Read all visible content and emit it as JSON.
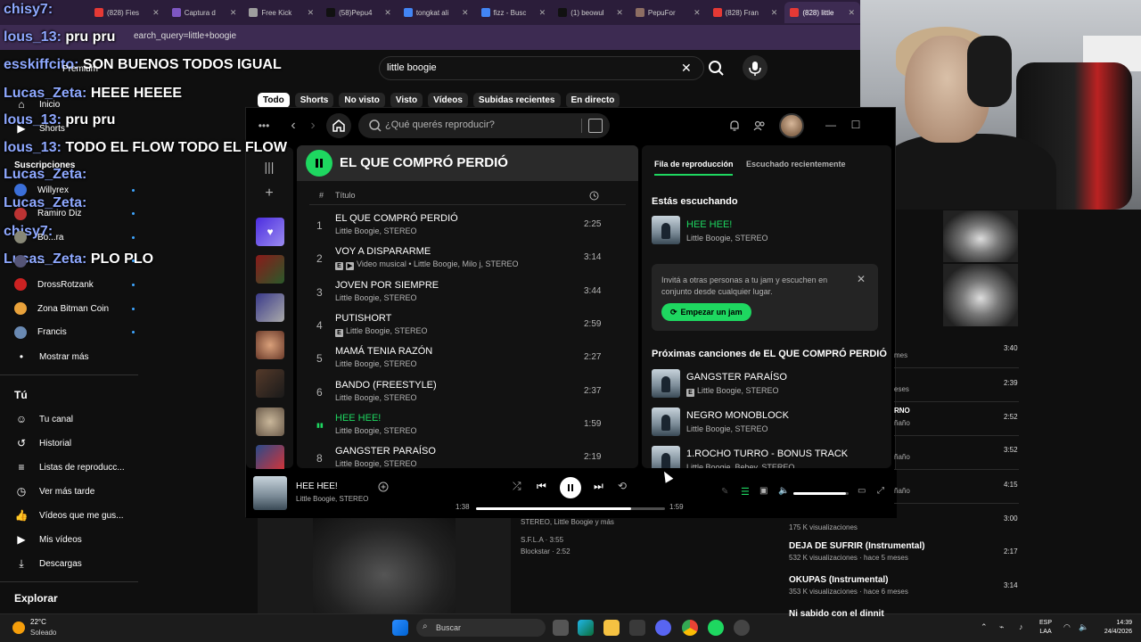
{
  "browser": {
    "tabs": [
      {
        "label": "(828) Fies",
        "color": "#e53935"
      },
      {
        "label": "Captura d",
        "color": "#7e57c2"
      },
      {
        "label": "Free Kick",
        "color": "#9e9e9e"
      },
      {
        "label": "(58)Pepu4",
        "color": "#111111"
      },
      {
        "label": "tongkat ali",
        "color": "#4285f4"
      },
      {
        "label": "fizz - Busc",
        "color": "#4285f4"
      },
      {
        "label": "(1) beowul",
        "color": "#111111"
      },
      {
        "label": "PepuFor",
        "color": "#8d6e63"
      },
      {
        "label": "(828) Fran",
        "color": "#e53935"
      },
      {
        "label": "(828) little",
        "color": "#e53935"
      }
    ],
    "url_fragment": "earch_query=little+boogie"
  },
  "youtube": {
    "search_value": "little boogie",
    "premium_label": "Premium",
    "chips": [
      "Todo",
      "Shorts",
      "No visto",
      "Visto",
      "Vídeos",
      "Subidas recientes",
      "En directo"
    ],
    "nav_main": [
      {
        "label": "Inicio",
        "icon": "home-icon"
      },
      {
        "label": "Shorts",
        "icon": "shorts-icon"
      }
    ],
    "subs_header": "Suscripciones",
    "subscriptions": [
      "Willyrex",
      "Ramiro Diz",
      "Bo...ra",
      "...",
      "DrossRotzank",
      "Zona Bitman Coin",
      "Francis"
    ],
    "show_more": "Mostrar más",
    "you_header": "Tú",
    "you_items": [
      {
        "label": "Tu canal",
        "icon": "channel-icon"
      },
      {
        "label": "Historial",
        "icon": "history-icon"
      },
      {
        "label": "Listas de reproducc...",
        "icon": "playlist-icon"
      },
      {
        "label": "Ver más tarde",
        "icon": "clock-icon"
      },
      {
        "label": "Vídeos que me gus...",
        "icon": "like-icon"
      },
      {
        "label": "Mis vídeos",
        "icon": "video-icon"
      },
      {
        "label": "Descargas",
        "icon": "download-icon"
      }
    ],
    "explore_header": "Explorar",
    "under_thumb": [
      "STEREO, Little Boogie y más",
      "S.F.L.A · 3:55",
      "Blockstar · 2:52"
    ],
    "right_durations": [
      "3:40",
      "2:39",
      "2:52",
      "3:52",
      "4:15",
      "3:00",
      "2:17",
      "3:14"
    ],
    "right_partials": [
      "mes",
      "eses",
      "RNO",
      "ñaño",
      "ñaño",
      "ñaño",
      "ñaño"
    ],
    "results": [
      {
        "title": "",
        "meta": "175 K visualizaciones"
      },
      {
        "title": "DEJA DE SUFRIR (Instrumental)",
        "meta": "532 K visualizaciones · hace 5 meses"
      },
      {
        "title": "OKUPAS (Instrumental)",
        "meta": "353 K visualizaciones · hace 6 meses"
      },
      {
        "title": "Ni sabido con el dinnit",
        "meta": ""
      }
    ]
  },
  "chat": [
    {
      "user": "chisy7:",
      "msg": ""
    },
    {
      "user": "lous_13:",
      "msg": " pru pru"
    },
    {
      "user": "esskiffcito:",
      "msg": " SON BUENOS TODOS IGUAL"
    },
    {
      "user": "Lucas_Zeta:",
      "msg": " HEEE HEEEE"
    },
    {
      "user": "lous_13:",
      "msg": " pru pru"
    },
    {
      "user": "lous_13:",
      "msg": " TODO EL FLOW TODO EL FLOW"
    },
    {
      "user": "Lucas_Zeta:",
      "msg": ""
    },
    {
      "user": "Lucas_Zeta:",
      "msg": ""
    },
    {
      "user": "chisy7:",
      "msg": ""
    },
    {
      "user": "Lucas_Zeta:",
      "msg": " PLO PLO"
    }
  ],
  "spotify": {
    "search_placeholder": "¿Qué querés reproducir?",
    "playlist_title": "EL QUE COMPRÓ PERDIÓ",
    "col_number": "#",
    "col_title": "Título",
    "tracks": [
      {
        "n": "1",
        "title": "EL QUE COMPRÓ PERDIÓ",
        "artist": "Little Boogie, STEREO",
        "dur": "2:25",
        "explicit": false,
        "video": false,
        "playing": false
      },
      {
        "n": "2",
        "title": "VOY A DISPARARME",
        "artist": "Video musical • Little Boogie, Milo j, STEREO",
        "dur": "3:14",
        "explicit": true,
        "video": true,
        "playing": false
      },
      {
        "n": "3",
        "title": "JOVEN POR SIEMPRE",
        "artist": "Little Boogie, STEREO",
        "dur": "3:44",
        "explicit": false,
        "video": false,
        "playing": false
      },
      {
        "n": "4",
        "title": "PUTISHORT",
        "artist": "Little Boogie, STEREO",
        "dur": "2:59",
        "explicit": true,
        "video": false,
        "playing": false
      },
      {
        "n": "5",
        "title": "MAMÁ TENIA RAZÓN",
        "artist": "Little Boogie, STEREO",
        "dur": "2:27",
        "explicit": false,
        "video": false,
        "playing": false
      },
      {
        "n": "6",
        "title": "BANDO (FREESTYLE)",
        "artist": "Little Boogie, STEREO",
        "dur": "2:37",
        "explicit": false,
        "video": false,
        "playing": false
      },
      {
        "n": "",
        "title": "HEE HEE!",
        "artist": "Little Boogie, STEREO",
        "dur": "1:59",
        "explicit": false,
        "video": false,
        "playing": true
      },
      {
        "n": "8",
        "title": "GANGSTER PARAÍSO",
        "artist": "Little Boogie, STEREO",
        "dur": "2:19",
        "explicit": false,
        "video": false,
        "playing": false
      }
    ],
    "side_tabs": [
      "Fila de reproducción",
      "Escuchado recientemente"
    ],
    "now_listening_header": "Estás escuchando",
    "now_listening": {
      "title": "HEE HEE!",
      "artist": "Little Boogie, STEREO"
    },
    "jam_text": "Invitá a otras personas a tu jam y escuchen en conjunto desde cualquier lugar.",
    "jam_button": "Empezar un jam",
    "next_header": "Próximas canciones de EL QUE COMPRÓ PERDIÓ",
    "next": [
      {
        "title": "GANGSTER PARAÍSO",
        "artist": "Little Boogie, STEREO",
        "explicit": true
      },
      {
        "title": "NEGRO MONOBLOCK",
        "artist": "Little Boogie, STEREO",
        "explicit": false
      },
      {
        "title": "1.ROCHO TURRO - BONUS TRACK",
        "artist": "Little Boogie, Bebey, STEREO",
        "explicit": false
      }
    ],
    "player": {
      "title": "HEE HEE!",
      "artist": "Little Boogie, STEREO",
      "elapsed": "1:38",
      "total": "1:59",
      "progress": 0.82,
      "volume": 0.95
    },
    "accent": "#1ed760"
  },
  "taskbar": {
    "temp": "22°C",
    "condition": "Soleado",
    "search": "Buscar",
    "lang_top": "ESP",
    "lang_bottom": "LAA",
    "time": "14:39",
    "date": "24/4/2026"
  }
}
